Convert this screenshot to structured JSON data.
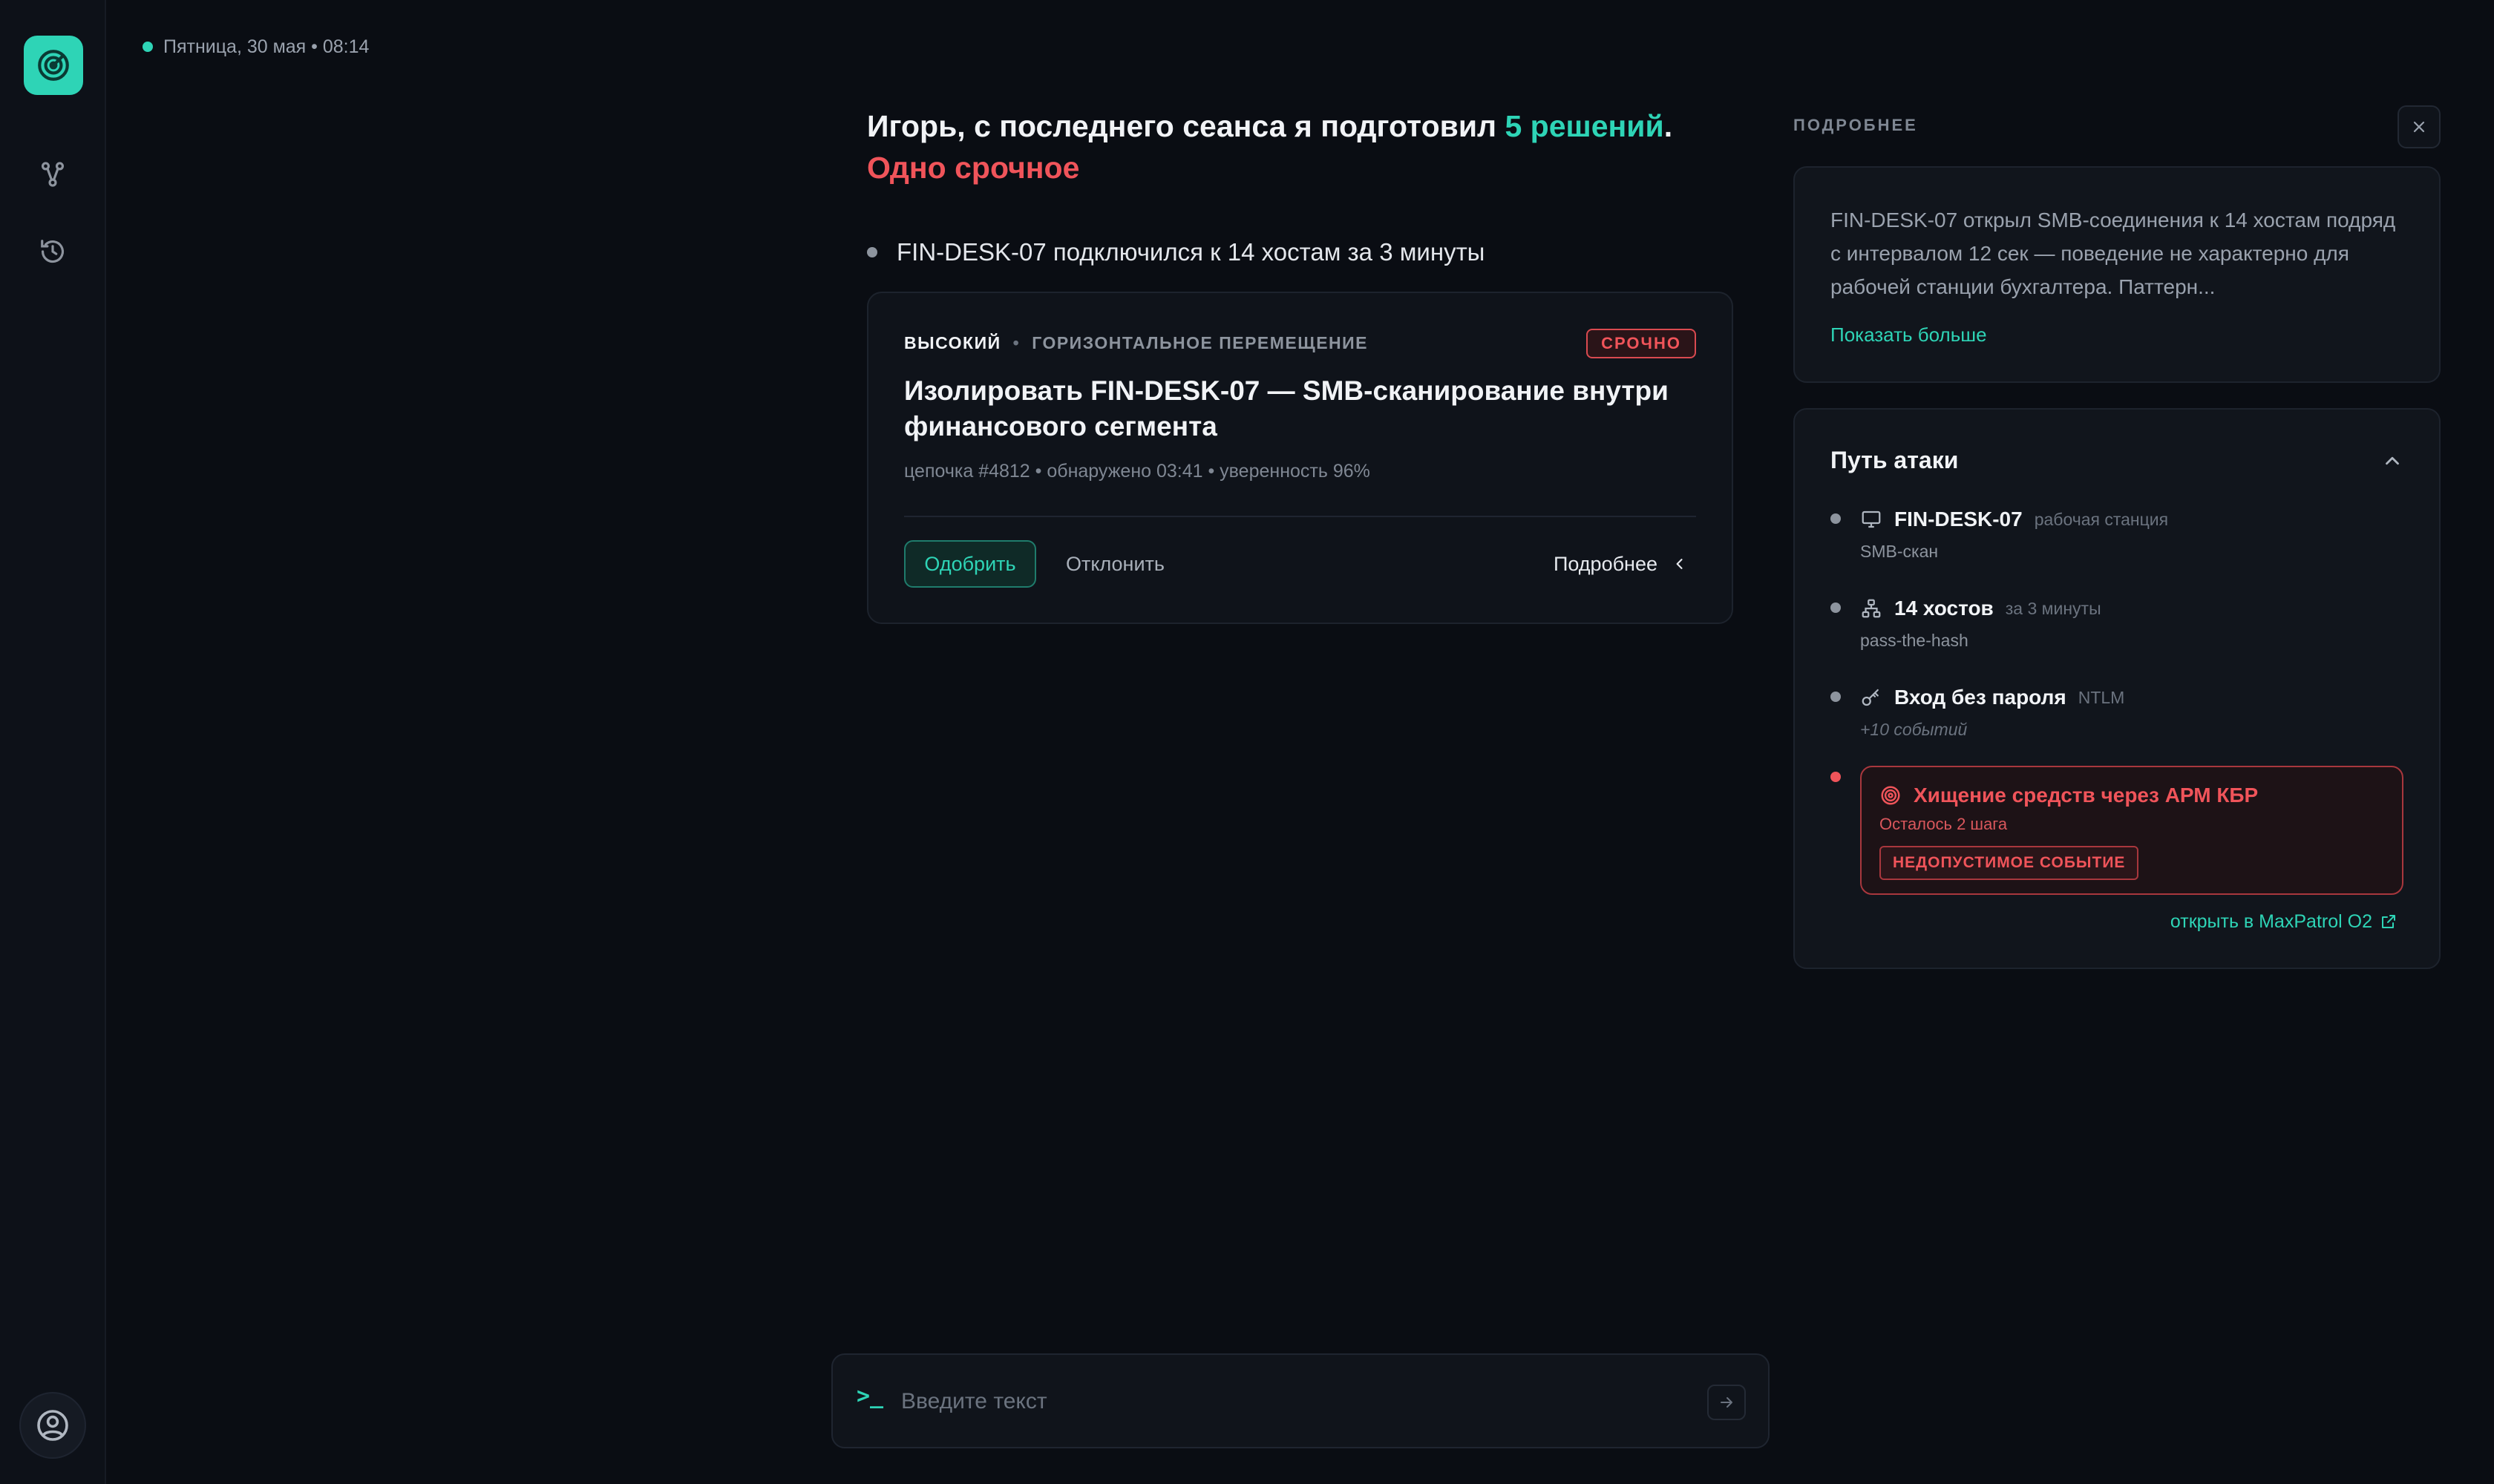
{
  "status": {
    "datetime": "Пятница, 30 мая • 08:14"
  },
  "headline": {
    "lead": "Игорь, с последнего сеанса я подготовил ",
    "count": "5 решений",
    "dot": ".",
    "urgent": "Одно срочное"
  },
  "event": {
    "text": "FIN-DESK-07 подключился к 14 хостам за 3 минуты"
  },
  "card": {
    "severity": "ВЫСОКИЙ",
    "separator": "•",
    "category": "ГОРИЗОНТАЛЬНОЕ ПЕРЕМЕЩЕНИЕ",
    "badge": "СРОЧНО",
    "title": "Изолировать FIN-DESK-07 — SMB-сканирование внутри финансового сегмента",
    "meta": "цепочка #4812 • обнаружено 03:41 • уверенность 96%",
    "approve": "Одобрить",
    "reject": "Отклонить",
    "details": "Подробнее"
  },
  "input": {
    "placeholder": "Введите текст",
    "prompt": ">_"
  },
  "panel": {
    "label": "ПОДРОБНЕЕ",
    "description": "FIN-DESK-07 открыл SMB-соединения к 14 хостам подряд с интервалом 12 сек — поведение не характерно для рабочей станции бухгалтера. Паттерн...",
    "show_more": "Показать больше",
    "attack": {
      "title": "Путь атаки",
      "steps": [
        {
          "label": "FIN-DESK-07",
          "hint": "рабочая станция",
          "sub": "SMB-скан",
          "icon": "monitor-icon"
        },
        {
          "label": "14 хостов",
          "hint": "за 3 минуты",
          "sub": "pass-the-hash",
          "icon": "network-icon"
        },
        {
          "label": "Вход без пароля",
          "hint": "NTLM",
          "sub": "+10 событий",
          "icon": "key-icon"
        }
      ],
      "target": {
        "title": "Хищение средств через АРМ КБР",
        "steps_left": "Осталось 2 шага",
        "tag": "НЕДОПУСТИМОЕ СОБЫТИЕ",
        "icon": "target-icon"
      },
      "link": "открыть в MaxPatrol O2"
    }
  },
  "colors": {
    "accent": "#2ed4b6",
    "danger": "#f0545a",
    "background": "#0a0d13"
  }
}
